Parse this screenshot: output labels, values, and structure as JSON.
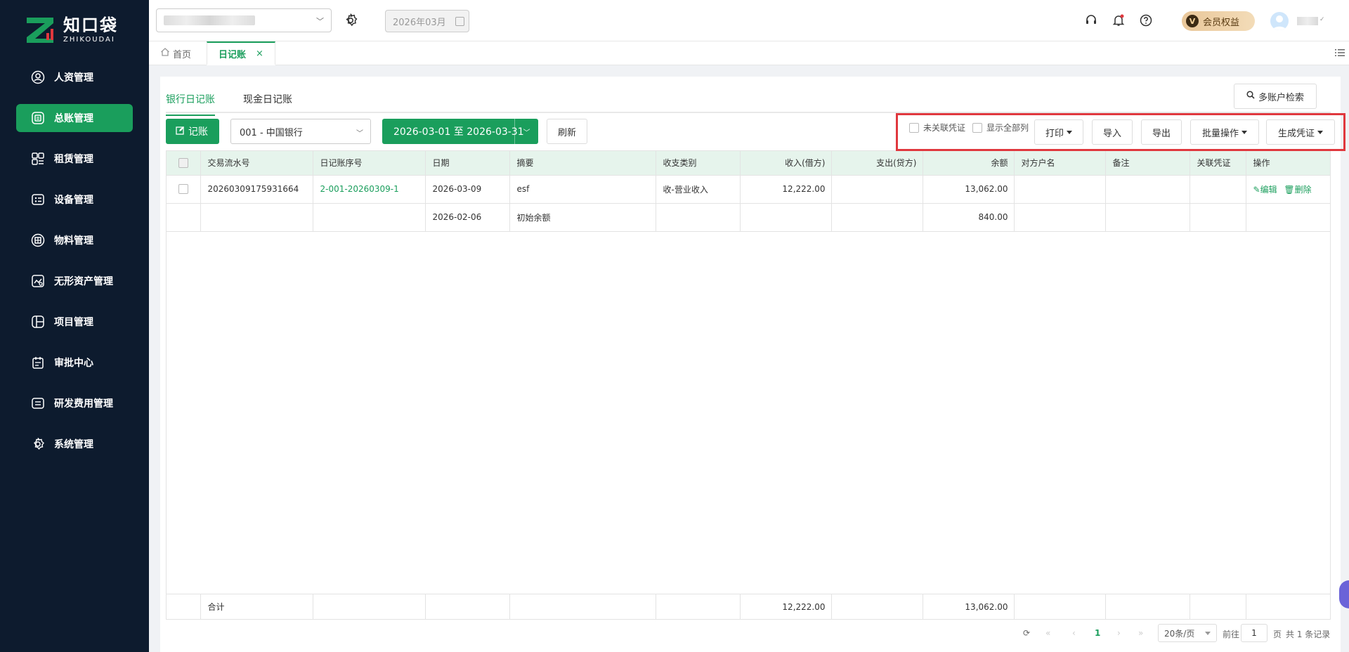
{
  "brand": {
    "name_cn": "知口袋",
    "name_en": "ZHIKOUDAI"
  },
  "sidebar": {
    "items": [
      {
        "label": "人资管理",
        "icon": "person-icon"
      },
      {
        "label": "总账管理",
        "icon": "ledger-icon",
        "active": true
      },
      {
        "label": "租赁管理",
        "icon": "lease-icon"
      },
      {
        "label": "设备管理",
        "icon": "device-icon"
      },
      {
        "label": "物料管理",
        "icon": "material-icon"
      },
      {
        "label": "无形资产管理",
        "icon": "intangible-asset-icon"
      },
      {
        "label": "项目管理",
        "icon": "project-icon"
      },
      {
        "label": "审批中心",
        "icon": "approval-icon"
      },
      {
        "label": "研发费用管理",
        "icon": "rd-expense-icon"
      },
      {
        "label": "系统管理",
        "icon": "settings-icon"
      }
    ]
  },
  "topbar": {
    "month": "2026年03月",
    "vip_label": "会员权益",
    "vip_letter": "V"
  },
  "tabs": {
    "home": "首页",
    "active": "日记账",
    "close": "×"
  },
  "subtabs": {
    "bank": "银行日记账",
    "cash": "现金日记账",
    "multi_search": "多账户检索"
  },
  "toolbar": {
    "record": "记账",
    "account": "001 - 中国银行",
    "date_range": "2026-03-01 至 2026-03-31",
    "refresh": "刷新",
    "unlinked": "未关联凭证",
    "show_all": "显示全部列",
    "print": "打印",
    "import": "导入",
    "export": "导出",
    "batch": "批量操作",
    "voucher": "生成凭证"
  },
  "table": {
    "headers": [
      "交易流水号",
      "日记账序号",
      "日期",
      "摘要",
      "收支类别",
      "收入(借方)",
      "支出(贷方)",
      "余额",
      "对方户名",
      "备注",
      "关联凭证",
      "操作"
    ],
    "rows": [
      {
        "serial": "20260309175931664",
        "seq": "2-001-20260309-1",
        "date": "2026-03-09",
        "summary": "esf",
        "category": "收-营业收入",
        "income": "12,222.00",
        "expense": "",
        "balance": "13,062.00",
        "counterparty": "",
        "note": "",
        "voucher": "",
        "edit": "编辑",
        "delete": "删除"
      },
      {
        "serial": "",
        "seq": "",
        "date": "2026-02-06",
        "summary": "初始余额",
        "category": "",
        "income": "",
        "expense": "",
        "balance": "840.00",
        "counterparty": "",
        "note": "",
        "voucher": ""
      }
    ],
    "footer": {
      "label": "合计",
      "income": "12,222.00",
      "balance": "13,062.00"
    }
  },
  "pager": {
    "current": "1",
    "page_size": "20条/页",
    "goto_prefix": "前往",
    "goto_value": "1",
    "goto_suffix": "页",
    "total": "共 1 条记录"
  },
  "colors": {
    "accent": "#1a9e5c",
    "sidebar_bg": "#0d1b2e",
    "highlight_box": "#e0383e",
    "header_bg": "#e6f4ec"
  }
}
